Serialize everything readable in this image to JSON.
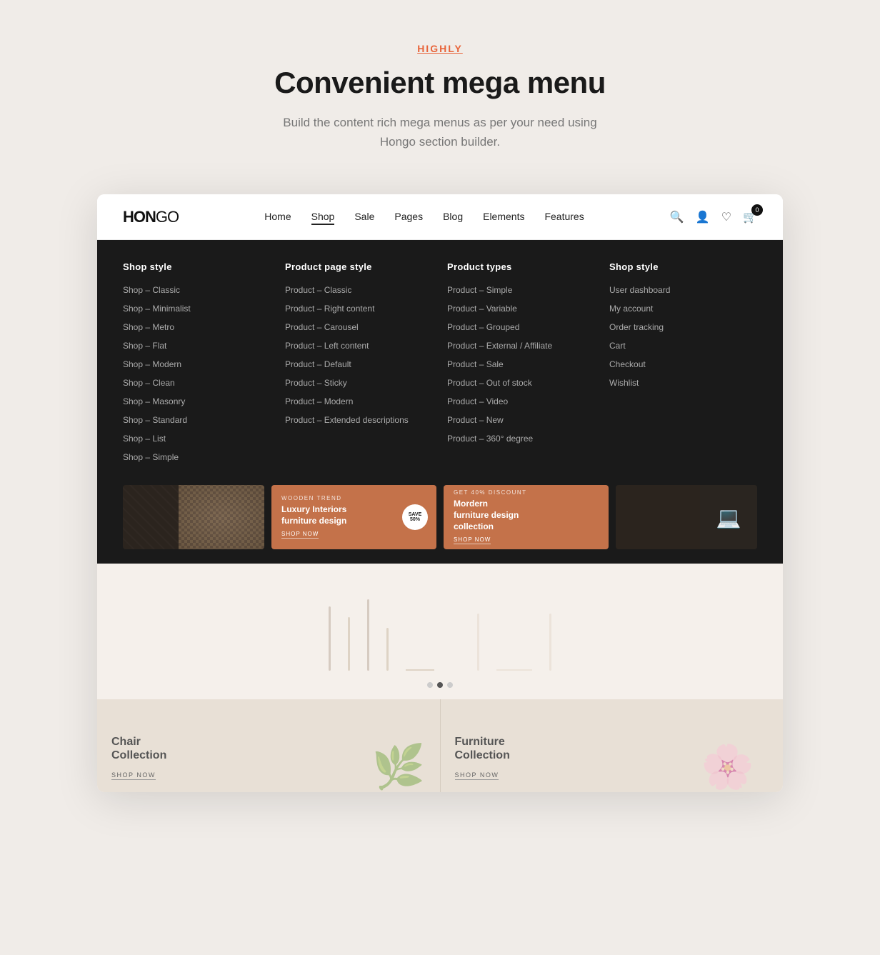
{
  "header": {
    "label": "HIGHLY",
    "title": "Convenient mega menu",
    "description": "Build the content rich mega menus as per your need using Hongo section builder."
  },
  "navbar": {
    "logo": "HON",
    "logo_bold": "GO",
    "menu_items": [
      {
        "label": "Home",
        "active": false
      },
      {
        "label": "Shop",
        "active": true
      },
      {
        "label": "Sale",
        "active": false
      },
      {
        "label": "Pages",
        "active": false
      },
      {
        "label": "Blog",
        "active": false
      },
      {
        "label": "Elements",
        "active": false
      },
      {
        "label": "Features",
        "active": false
      }
    ],
    "cart_count": "0"
  },
  "mega_menu": {
    "columns": [
      {
        "title": "Shop style",
        "items": [
          "Shop – Classic",
          "Shop – Minimalist",
          "Shop – Metro",
          "Shop – Flat",
          "Shop – Modern",
          "Shop – Clean",
          "Shop – Masonry",
          "Shop – Standard",
          "Shop – List",
          "Shop – Simple"
        ]
      },
      {
        "title": "Product page style",
        "items": [
          "Product – Classic",
          "Product – Right content",
          "Product – Carousel",
          "Product – Left content",
          "Product – Default",
          "Product – Sticky",
          "Product – Modern",
          "Product – Extended descriptions"
        ]
      },
      {
        "title": "Product types",
        "items": [
          "Product – Simple",
          "Product – Variable",
          "Product – Grouped",
          "Product – External / Affiliate",
          "Product – Sale",
          "Product – Out of stock",
          "Product – Video",
          "Product – New",
          "Product – 360° degree"
        ]
      },
      {
        "title": "Shop style",
        "items": [
          "User dashboard",
          "My account",
          "Order tracking",
          "Cart",
          "Checkout",
          "Wishlist"
        ]
      }
    ],
    "banners": [
      {
        "type": "wicker",
        "tag": "",
        "title": "",
        "shop_now": ""
      },
      {
        "type": "orange",
        "tag": "WOODEN TREND",
        "title": "Luxury Interiors furniture design",
        "shop_now": "SHOP NOW",
        "badge": "SAVE\n50%"
      },
      {
        "type": "orange",
        "tag": "GET 40% DISCOUNT",
        "title": "Mordern furniture design collection",
        "shop_now": "SHOP NOW"
      },
      {
        "type": "dark",
        "tag": "",
        "title": "",
        "shop_now": ""
      }
    ]
  },
  "collections": [
    {
      "title": "Chair\nCollection",
      "link": "SHOP NOW"
    },
    {
      "title": "Furniture\nCollection",
      "link": "SHOP NOW"
    }
  ],
  "pagination": {
    "dots": [
      false,
      true,
      false
    ]
  }
}
